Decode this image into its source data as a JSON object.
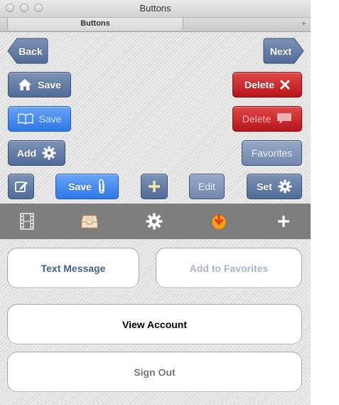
{
  "window": {
    "title": "Buttons"
  },
  "tabs": {
    "active": "Buttons",
    "add_symbol": "+"
  },
  "nav": {
    "back_label": "Back",
    "next_label": "Next"
  },
  "buttons": {
    "save_home": "Save",
    "delete": "Delete",
    "save_book": "Save",
    "delete_message": "Delete",
    "add": "Add",
    "favorites": "Favorites",
    "save_clip": "Save",
    "edit": "Edit",
    "set": "Set"
  },
  "toolbar": {
    "icons": [
      "film-icon",
      "inbox-icon",
      "gear-icon",
      "download-icon",
      "plus-icon"
    ]
  },
  "actions": {
    "text_message": "Text Message",
    "add_to_favorites": "Add to Favorites",
    "view_account": "View Account",
    "sign_out": "Sign Out"
  },
  "colors": {
    "steel_blue": "#5d77a3",
    "bright_blue": "#3b82ec",
    "red": "#c4181d",
    "toolbar_gray": "#7e7e7e",
    "text_message_color": "#44608e",
    "add_to_favorites_color": "#a6b4c9",
    "sign_out_color": "#777777"
  }
}
